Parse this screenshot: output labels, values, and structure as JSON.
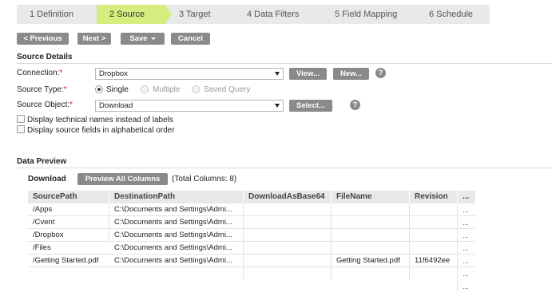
{
  "wizard": {
    "steps": [
      {
        "label": "1  Definition"
      },
      {
        "label": "2  Source",
        "active": true
      },
      {
        "label": "3  Target"
      },
      {
        "label": "4  Data Filters"
      },
      {
        "label": "5  Field Mapping"
      },
      {
        "label": "6  Schedule"
      }
    ],
    "active_color": "#d5ec7e"
  },
  "actions": {
    "previous": "< Previous",
    "next": "Next >",
    "save": "Save",
    "cancel": "Cancel"
  },
  "source_details": {
    "title": "Source Details",
    "connection_label": "Connection:",
    "connection_value": "Dropbox",
    "view_button": "View...",
    "new_button": "New...",
    "source_type_label": "Source Type:",
    "source_types": [
      "Single",
      "Multiple",
      "Saved Query"
    ],
    "source_type_selected": "Single",
    "source_object_label": "Source Object:",
    "source_object_value": "Download",
    "select_button": "Select...",
    "help_glyph": "?",
    "required_mark": "*",
    "option_technical_names": "Display technical names instead of labels",
    "option_alphabetical": "Display source fields in alphabetical order"
  },
  "data_preview": {
    "title": "Data Preview",
    "object_name": "Download",
    "preview_all_button": "Preview All Columns",
    "total_columns": "(Total Columns: 8)",
    "columns": [
      "SourcePath",
      "DestinationPath",
      "DownloadAsBase64",
      "FileName",
      "Revision",
      "..."
    ],
    "rows": [
      [
        "/Apps",
        "C:\\Documents and Settings\\Admi...",
        "",
        "",
        "",
        "..."
      ],
      [
        "/Cvent",
        "C:\\Documents and Settings\\Admi...",
        "",
        "",
        "",
        "..."
      ],
      [
        "/Dropbox",
        "C:\\Documents and Settings\\Admi...",
        "",
        "",
        "",
        "..."
      ],
      [
        "/Files",
        "C:\\Documents and Settings\\Admi...",
        "",
        "",
        "",
        "..."
      ],
      [
        "/Getting Started.pdf",
        "C:\\Documents and Settings\\Admi...",
        "",
        "Getting Started.pdf",
        "11f6492ee",
        "..."
      ],
      [
        "",
        "",
        "",
        "",
        "",
        "..."
      ],
      [
        "",
        "",
        "",
        "",
        "",
        "..."
      ]
    ]
  }
}
